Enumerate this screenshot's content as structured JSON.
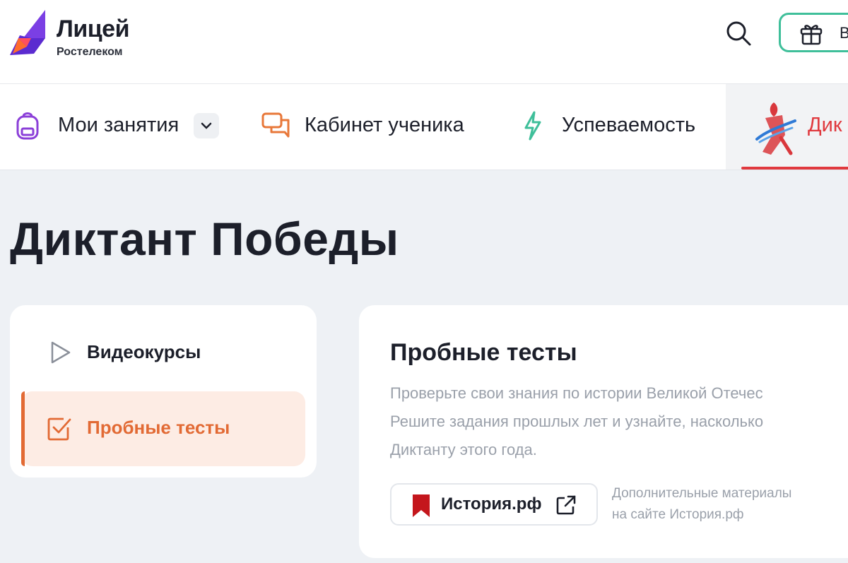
{
  "header": {
    "brand_name": "Лицей",
    "brand_sub": "Ростелеком",
    "gift_label": "В",
    "accent_color": "#3fbf9a"
  },
  "nav": {
    "items": [
      {
        "label": "Мои занятия",
        "icon": "backpack-icon"
      },
      {
        "label": "Кабинет ученика",
        "icon": "chat-bubbles-icon"
      },
      {
        "label": "Успеваемость",
        "icon": "lightning-icon"
      },
      {
        "label": "Дик",
        "icon": "victory-emblem-icon"
      }
    ],
    "active_index": 3,
    "active_color": "#e0393e"
  },
  "page": {
    "title": "Диктант Победы"
  },
  "sidebar": {
    "items": [
      {
        "label": "Видеокурсы",
        "icon": "play-icon",
        "active": false
      },
      {
        "label": "Пробные тесты",
        "icon": "checkbox-icon",
        "active": true
      }
    ],
    "active_color": "#e26a34"
  },
  "main": {
    "title": "Пробные тесты",
    "description": [
      "Проверьте свои знания по истории Великой Отечес",
      "Решите задания прошлых лет и узнайте, насколько",
      "Диктанту этого года."
    ],
    "history_button_label": "История.рф",
    "extra_text": [
      "Дополнительные материалы",
      "на сайте История.рф"
    ]
  }
}
